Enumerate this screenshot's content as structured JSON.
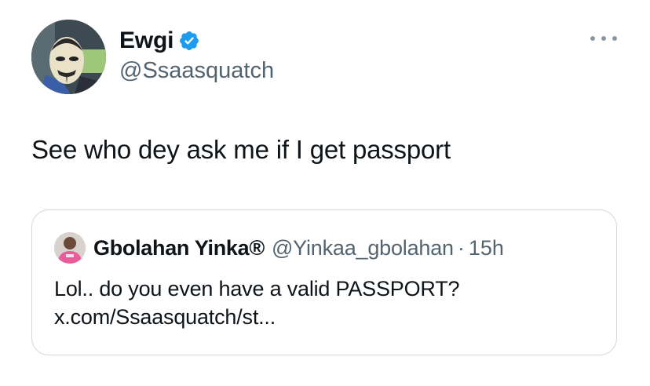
{
  "tweet": {
    "author": {
      "display_name": "Ewgi",
      "handle": "@Ssaasquatch",
      "verified_icon": "verified-badge-icon",
      "avatar_icon": "mask-avatar"
    },
    "more_icon": "more-options-icon",
    "text": "See who dey ask me if I get passport"
  },
  "quote": {
    "author": {
      "display_name": "Gbolahan Yinka®",
      "handle": "@Yinkaa_gbolahan",
      "separator": "·",
      "time": "15h",
      "avatar_icon": "user-avatar"
    },
    "text_line1": "Lol.. do you even have a valid PASSPORT?",
    "text_line2": "x.com/Ssaasquatch/st..."
  },
  "colors": {
    "text_primary": "#0f1419",
    "text_secondary": "#536471",
    "verified_blue": "#1d9bf0",
    "border": "#cfd9de"
  }
}
